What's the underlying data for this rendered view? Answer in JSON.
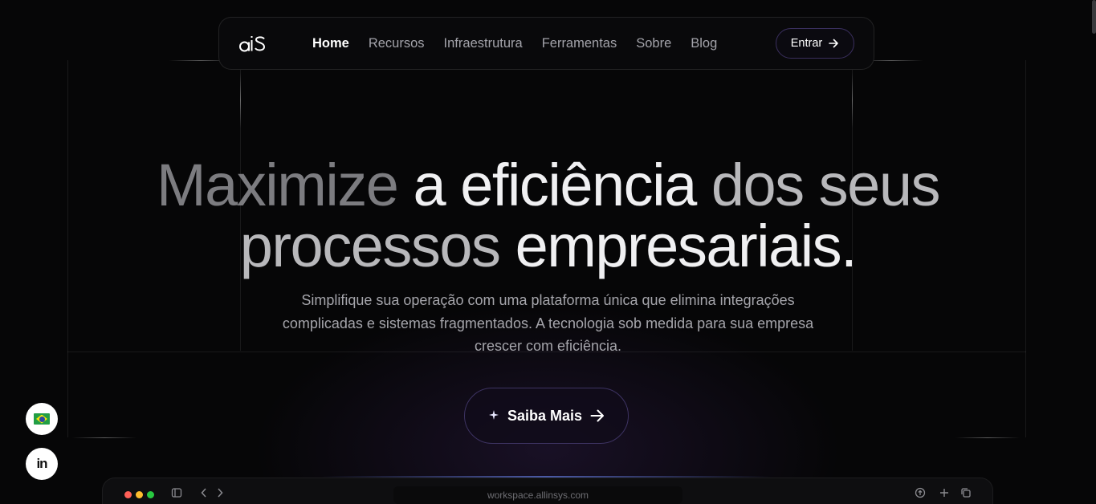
{
  "nav": {
    "logo_text": "aiS",
    "links": [
      {
        "label": "Home",
        "active": true
      },
      {
        "label": "Recursos",
        "active": false
      },
      {
        "label": "Infraestrutura",
        "active": false
      },
      {
        "label": "Ferramentas",
        "active": false
      },
      {
        "label": "Sobre",
        "active": false
      },
      {
        "label": "Blog",
        "active": false
      }
    ],
    "login_label": "Entrar"
  },
  "hero": {
    "headline_line1": {
      "part1": "Maximize",
      "part2": " a eficiência ",
      "part3": "dos seus"
    },
    "headline_line2": {
      "part1": "processos ",
      "part2": "empresariais."
    },
    "subtext": "Simplifique sua operação com uma plataforma única que elimina integrações complicadas e sistemas fragmentados. A tecnologia sob medida para sua empresa crescer com eficiência.",
    "cta_label": "Saiba Mais"
  },
  "floating": {
    "language_icon": "brazil-flag-icon",
    "linkedin_text": "in"
  },
  "browser_mock": {
    "url": "workspace.allinsys.com",
    "dot_colors": [
      "#ff5f57",
      "#febc2e",
      "#28c840"
    ]
  },
  "colors": {
    "accent_border": "#3d3362",
    "background": "#060607"
  }
}
